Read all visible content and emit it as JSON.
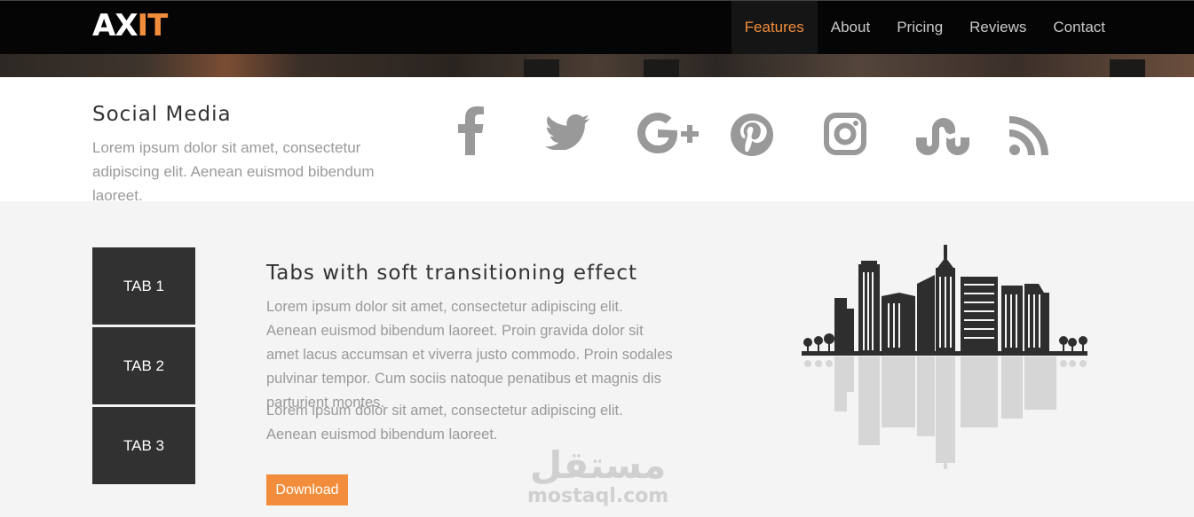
{
  "brand": {
    "logo_main": "AX",
    "logo_accent": "IT",
    "accent_color": "#f28d3b"
  },
  "nav": {
    "items": [
      {
        "label": "Features",
        "active": true
      },
      {
        "label": "About",
        "active": false
      },
      {
        "label": "Pricing",
        "active": false
      },
      {
        "label": "Reviews",
        "active": false
      },
      {
        "label": "Contact",
        "active": false
      }
    ]
  },
  "social": {
    "title": "Social Media",
    "text": "Lorem ipsum dolor sit amet, consectetur adipiscing elit. Aenean euismod bibendum laoreet.",
    "icons": [
      "facebook-icon",
      "twitter-icon",
      "google-plus-icon",
      "pinterest-icon",
      "instagram-icon",
      "stumbleupon-icon",
      "rss-icon"
    ]
  },
  "tabs": {
    "items": [
      {
        "label": "TAB 1"
      },
      {
        "label": "TAB 2"
      },
      {
        "label": "TAB 3"
      }
    ],
    "content": {
      "title": "Tabs with soft transitioning effect",
      "paragraph1": "Lorem ipsum dolor sit amet, consectetur adipiscing elit. Aenean euismod bibendum laoreet. Proin gravida dolor sit amet lacus accumsan et viverra justo commodo. Proin sodales pulvinar tempor. Cum sociis natoque penatibus et magnis dis parturient montes.",
      "paragraph2": "Lorem ipsum dolor sit amet, consectetur adipiscing elit. Aenean euismod bibendum laoreet.",
      "button_label": "Download"
    }
  },
  "watermark": {
    "arabic": "مستقل",
    "latin": "mostaql.com"
  }
}
